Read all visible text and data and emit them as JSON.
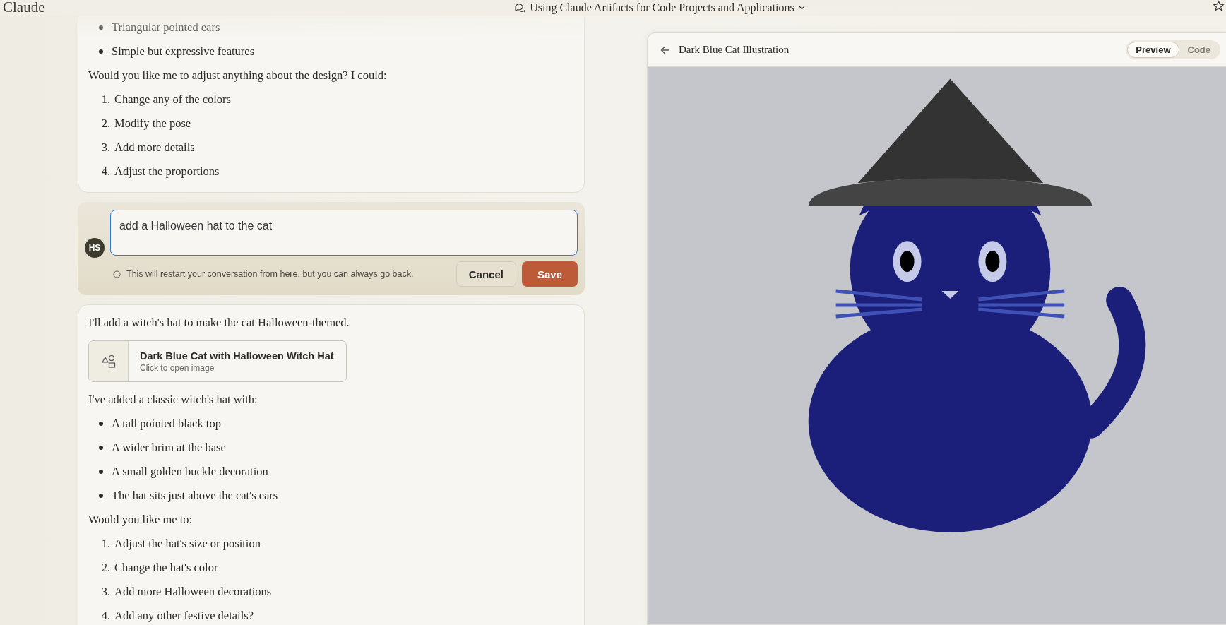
{
  "header": {
    "app_name": "Claude",
    "chat_title": "Using Claude Artifacts for Code Projects and Applications"
  },
  "messages": [
    {
      "kind": "assistant",
      "blocks": [
        {
          "kind": "bullets",
          "items": [
            "Triangular pointed ears",
            "Simple but expressive features"
          ]
        },
        {
          "kind": "paragraph",
          "text": "Would you like me to adjust anything about the design? I could:"
        },
        {
          "kind": "numbered",
          "items": [
            {
              "number": "1.",
              "text": "Change any of the colors"
            },
            {
              "number": "2.",
              "text": "Modify the pose"
            },
            {
              "number": "3.",
              "text": "Add more details"
            },
            {
              "number": "4.",
              "text": "Adjust the proportions"
            }
          ]
        }
      ]
    },
    {
      "kind": "edit",
      "avatar": "HS",
      "value": "add a Halloween hat to the cat",
      "note": "This will restart your conversation from here, but you can always go back.",
      "cancel": "Cancel",
      "save": "Save"
    },
    {
      "kind": "assistant",
      "blocks": [
        {
          "kind": "paragraph",
          "text": "I'll add a witch's hat to make the cat Halloween-themed."
        },
        {
          "kind": "artifact",
          "title": "Dark Blue Cat with Halloween Witch Hat",
          "subtitle": "Click to open image"
        },
        {
          "kind": "paragraph",
          "text": "I've added a classic witch's hat with:"
        },
        {
          "kind": "bullets",
          "items": [
            "A tall pointed black top",
            "A wider brim at the base",
            "A small golden buckle decoration",
            "The hat sits just above the cat's ears"
          ]
        },
        {
          "kind": "paragraph",
          "text": "Would you like me to:"
        },
        {
          "kind": "numbered",
          "items": [
            {
              "number": "1.",
              "text": "Adjust the hat's size or position"
            },
            {
              "number": "2.",
              "text": "Change the hat's color"
            },
            {
              "number": "3.",
              "text": "Add more Halloween decorations"
            },
            {
              "number": "4.",
              "text": "Add any other festive details?"
            }
          ]
        }
      ]
    }
  ],
  "artifact": {
    "title": "Dark Blue Cat Illustration",
    "tabs": [
      {
        "label": "Preview",
        "selected": true
      },
      {
        "label": "Code",
        "selected": false
      }
    ]
  }
}
